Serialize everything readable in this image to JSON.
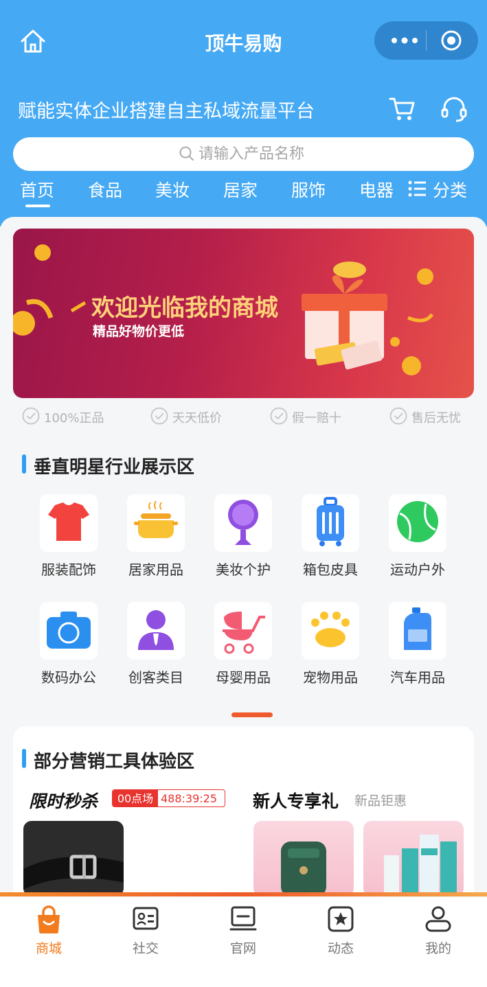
{
  "app": {
    "title": "顶牛易购",
    "slogan": "赋能实体企业搭建自主私域流量平台"
  },
  "search": {
    "placeholder": "请输入产品名称"
  },
  "tabs": [
    {
      "label": "首页",
      "active": true
    },
    {
      "label": "食品"
    },
    {
      "label": "美妆"
    },
    {
      "label": "居家"
    },
    {
      "label": "服饰"
    },
    {
      "label": "电器"
    }
  ],
  "category_tab": {
    "label": "分类"
  },
  "banner": {
    "title": "欢迎光临我的商城",
    "subtitle": "精品好物价更低"
  },
  "guarantees": [
    "100%正品",
    "天天低价",
    "假一赔十",
    "售后无忧"
  ],
  "section1": {
    "title": "垂直明星行业展示区"
  },
  "categories": [
    {
      "label": "服装配饰",
      "icon": "tshirt-icon"
    },
    {
      "label": "居家用品",
      "icon": "pot-icon"
    },
    {
      "label": "美妆个护",
      "icon": "mirror-icon"
    },
    {
      "label": "箱包皮具",
      "icon": "luggage-icon"
    },
    {
      "label": "运动户外",
      "icon": "ball-icon"
    },
    {
      "label": "数码办公",
      "icon": "camera-icon"
    },
    {
      "label": "创客类目",
      "icon": "person-icon"
    },
    {
      "label": "母婴用品",
      "icon": "stroller-icon"
    },
    {
      "label": "宠物用品",
      "icon": "paw-icon"
    },
    {
      "label": "汽车用品",
      "icon": "oil-can-icon"
    }
  ],
  "section2": {
    "title": "部分营销工具体验区"
  },
  "flash_sale": {
    "title": "限时秒杀",
    "session": "00点场",
    "countdown": "488:39:25"
  },
  "new_user": {
    "title": "新人专享礼",
    "subtitle": "新品钜惠"
  },
  "bottom_nav": [
    {
      "label": "商城",
      "icon": "shop-bag-icon",
      "active": true
    },
    {
      "label": "社交",
      "icon": "id-card-icon"
    },
    {
      "label": "官网",
      "icon": "laptop-icon"
    },
    {
      "label": "动态",
      "icon": "star-box-icon"
    },
    {
      "label": "我的",
      "icon": "user-icon"
    }
  ],
  "colors": {
    "header_blue": "#45a9f4",
    "accent_orange": "#f27b1e",
    "flash_red": "#e8332f",
    "section_bar": "#2e9ef3"
  }
}
